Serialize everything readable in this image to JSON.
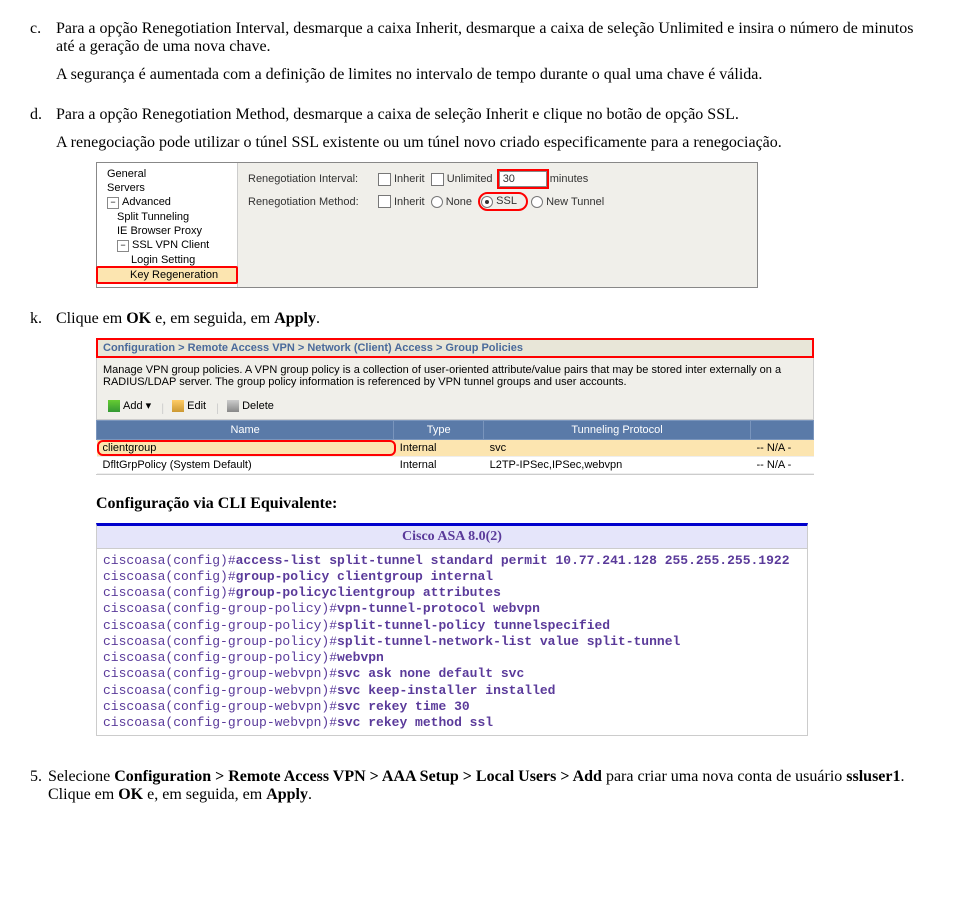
{
  "items": {
    "c": {
      "marker": "c.",
      "p1": "Para a opção Renegotiation Interval, desmarque a caixa Inherit, desmarque a caixa de seleção Unlimited e insira o número de minutos até a geração de uma nova chave.",
      "p2": "A segurança é aumentada com a definição de limites no intervalo de tempo durante o qual uma chave é válida."
    },
    "d": {
      "marker": "d.",
      "p1": "Para a opção Renegotiation Method, desmarque a caixa de seleção Inherit e clique no botão de opção SSL.",
      "p2": "A renegociação pode utilizar o túnel SSL existente ou um túnel novo criado especificamente para a renegociação."
    },
    "k": {
      "marker": "k.",
      "p1_pre": "Clique em ",
      "p1_b1": "OK",
      "p1_mid": " e, em seguida, em ",
      "p1_b2": "Apply",
      "p1_post": "."
    }
  },
  "screenshot1": {
    "tree": [
      "General",
      "Servers",
      "Advanced",
      "Split Tunneling",
      "IE Browser Proxy",
      "SSL VPN Client",
      "Login Setting",
      "Key Regeneration"
    ],
    "row1": {
      "label": "Renegotiation Interval:",
      "inherit": "Inherit",
      "unlimited": "Unlimited",
      "value": "30",
      "unit": "minutes"
    },
    "row2": {
      "label": "Renegotiation Method:",
      "inherit": "Inherit",
      "none": "None",
      "ssl": "SSL",
      "newtunnel": "New Tunnel"
    }
  },
  "screenshot2": {
    "breadcrumb": "Configuration > Remote Access VPN > Network (Client) Access > Group Policies",
    "desc": "Manage VPN group policies. A VPN group policy is a collection of user-oriented attribute/value pairs that may be stored inter externally on a RADIUS/LDAP server. The group policy information is referenced by VPN tunnel groups and user accounts.",
    "toolbar": {
      "add": "Add",
      "edit": "Edit",
      "delete": "Delete"
    },
    "headers": [
      "Name",
      "Type",
      "Tunneling Protocol",
      ""
    ],
    "rows": [
      {
        "name": "clientgroup",
        "type": "Internal",
        "proto": "svc",
        "last": "-- N/A -"
      },
      {
        "name": "DfltGrpPolicy (System Default)",
        "type": "Internal",
        "proto": "L2TP-IPSec,IPSec,webvpn",
        "last": "-- N/A -"
      }
    ]
  },
  "cli": {
    "title": "Configuração via CLI Equivalente:",
    "header": "Cisco ASA 8.0(2)",
    "lines": [
      {
        "p": "ciscoasa(config)#",
        "c": "access-list split-tunnel standard permit 10.77.241.128 255.255.255.1922"
      },
      {
        "p": "ciscoasa(config)#",
        "c": "group-policy clientgroup internal"
      },
      {
        "p": "ciscoasa(config)#",
        "c": "group-policyclientgroup attributes"
      },
      {
        "p": "ciscoasa(config-group-policy)#",
        "c": "vpn-tunnel-protocol webvpn"
      },
      {
        "p": "ciscoasa(config-group-policy)#",
        "c": "split-tunnel-policy tunnelspecified"
      },
      {
        "p": "ciscoasa(config-group-policy)#",
        "c": "split-tunnel-network-list value split-tunnel"
      },
      {
        "p": "ciscoasa(config-group-policy)#",
        "c": "webvpn"
      },
      {
        "p": "ciscoasa(config-group-webvpn)#",
        "c": "svc ask none default svc"
      },
      {
        "p": "ciscoasa(config-group-webvpn)#",
        "c": "svc keep-installer installed"
      },
      {
        "p": "ciscoasa(config-group-webvpn)#",
        "c": "svc rekey time 30"
      },
      {
        "p": "ciscoasa(config-group-webvpn)#",
        "c": "svc rekey method ssl"
      }
    ]
  },
  "step5": {
    "marker": "5.",
    "pre": "Selecione ",
    "b1": "Configuration > Remote Access VPN > AAA Setup > Local Users > Add",
    "mid": " para criar uma nova conta de usuário ",
    "b2": "ssluser1",
    "post": ". Clique em ",
    "b3": "OK",
    "post2": " e, em seguida, em ",
    "b4": "Apply",
    "post3": "."
  }
}
